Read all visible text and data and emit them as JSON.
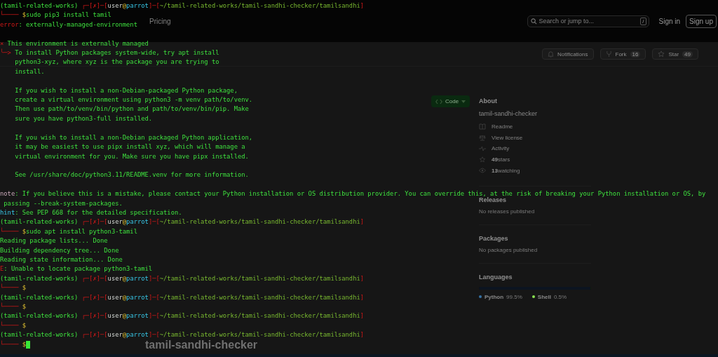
{
  "background_page": {
    "header": {
      "nav_item": "Pricing",
      "search": {
        "placeholder": "Search or jump to...",
        "shortcut": "/"
      },
      "sign_in": "Sign in",
      "sign_up": "Sign up"
    },
    "repo_actions": [
      {
        "kind": "notifications",
        "label": "Notifications"
      },
      {
        "kind": "fork",
        "label": "Fork",
        "count": "16"
      },
      {
        "kind": "star",
        "label": "Star",
        "count": "49"
      }
    ],
    "code_button": "Code",
    "about": {
      "title": "About",
      "description": "tamil-sandhi-checker",
      "links": [
        {
          "kind": "readme",
          "label": "Readme"
        },
        {
          "kind": "license",
          "label": "View license"
        },
        {
          "kind": "activity",
          "label": "Activity"
        },
        {
          "kind": "stars",
          "count": "49",
          "label": "stars"
        },
        {
          "kind": "watching",
          "count": "13",
          "label": "watching"
        }
      ]
    },
    "sections": [
      {
        "title": "Releases",
        "note": "No releases published"
      },
      {
        "title": "Packages",
        "note": "No packages published"
      }
    ],
    "languages": {
      "title": "Languages",
      "items": [
        {
          "name": "Python",
          "share": "99.5%",
          "level": 0.995,
          "color": "#3572a5"
        },
        {
          "name": "Shell",
          "share": "0.5%",
          "level": 0.005,
          "color": "#89e051"
        }
      ]
    },
    "repo_title": "tamil-sandhi-checker"
  },
  "terminal": {
    "lines": [
      {
        "kind": "text",
        "cursor": false,
        "segments": [
          {
            "kind": "env",
            "text": "(tamil-related-works) "
          },
          {
            "kind": "frame",
            "text": "┌─["
          },
          {
            "kind": "status",
            "text": "✗"
          },
          {
            "kind": "frame",
            "text": "]─["
          },
          {
            "kind": "user",
            "text": "user"
          },
          {
            "kind": "at",
            "text": "@"
          },
          {
            "kind": "host",
            "text": "parrot"
          },
          {
            "kind": "frame",
            "text": "]─["
          },
          {
            "kind": "path",
            "text": "~/tamil-related-works/tamil-sandhi-checker/tamilsandhi"
          },
          {
            "kind": "frame",
            "text": "]"
          }
        ]
      },
      {
        "kind": "text",
        "cursor": false,
        "segments": [
          {
            "kind": "frame",
            "text": "└──── "
          },
          {
            "kind": "dollar",
            "text": "$"
          },
          {
            "kind": "plain",
            "text": "sudo pip3 install tamil"
          }
        ]
      },
      {
        "kind": "text",
        "cursor": false,
        "segments": [
          {
            "kind": "error",
            "text": "error"
          },
          {
            "kind": "plain",
            "text": ": externally-managed-environment"
          }
        ]
      },
      {
        "kind": "blank"
      },
      {
        "kind": "text",
        "cursor": false,
        "segments": [
          {
            "kind": "error",
            "text": "× "
          },
          {
            "kind": "plain",
            "text": "This environment is externally managed"
          }
        ]
      },
      {
        "kind": "text",
        "cursor": false,
        "segments": [
          {
            "kind": "error",
            "text": "╰─> "
          },
          {
            "kind": "plain",
            "text": "To install Python packages system-wide, try apt install"
          }
        ]
      },
      {
        "kind": "text",
        "cursor": false,
        "segments": [
          {
            "kind": "plain",
            "text": "    python3-xyz, where xyz is the package you are trying to"
          }
        ]
      },
      {
        "kind": "text",
        "cursor": false,
        "segments": [
          {
            "kind": "plain",
            "text": "    install."
          }
        ]
      },
      {
        "kind": "blank"
      },
      {
        "kind": "text",
        "cursor": false,
        "segments": [
          {
            "kind": "plain",
            "text": "    If you wish to install a non-Debian-packaged Python package,"
          }
        ]
      },
      {
        "kind": "text",
        "cursor": false,
        "segments": [
          {
            "kind": "plain",
            "text": "    create a virtual environment using python3 -m venv path/to/venv."
          }
        ]
      },
      {
        "kind": "text",
        "cursor": false,
        "segments": [
          {
            "kind": "plain",
            "text": "    Then use path/to/venv/bin/python and path/to/venv/bin/pip. Make"
          }
        ]
      },
      {
        "kind": "text",
        "cursor": false,
        "segments": [
          {
            "kind": "plain",
            "text": "    sure you have python3-full installed."
          }
        ]
      },
      {
        "kind": "blank"
      },
      {
        "kind": "text",
        "cursor": false,
        "segments": [
          {
            "kind": "plain",
            "text": "    If you wish to install a non-Debian packaged Python application,"
          }
        ]
      },
      {
        "kind": "text",
        "cursor": false,
        "segments": [
          {
            "kind": "plain",
            "text": "    it may be easiest to use pipx install xyz, which will manage a"
          }
        ]
      },
      {
        "kind": "text",
        "cursor": false,
        "segments": [
          {
            "kind": "plain",
            "text": "    virtual environment for you. Make sure you have pipx installed."
          }
        ]
      },
      {
        "kind": "blank"
      },
      {
        "kind": "text",
        "cursor": false,
        "segments": [
          {
            "kind": "plain",
            "text": "    See /usr/share/doc/python3.11/README.venv for more information."
          }
        ]
      },
      {
        "kind": "blank"
      },
      {
        "kind": "text",
        "cursor": false,
        "segments": [
          {
            "kind": "note",
            "text": "note"
          },
          {
            "kind": "plain",
            "text": ": If you believe this is a mistake, please contact your Python installation or OS distribution provider. You can override this, at the risk of breaking your Python installation or OS, by"
          }
        ]
      },
      {
        "kind": "text",
        "cursor": false,
        "segments": [
          {
            "kind": "plain",
            "text": " passing --break-system-packages."
          }
        ]
      },
      {
        "kind": "text",
        "cursor": false,
        "segments": [
          {
            "kind": "hint",
            "text": "hint"
          },
          {
            "kind": "plain",
            "text": ": See PEP 668 for the detailed specification."
          }
        ]
      },
      {
        "kind": "text",
        "cursor": false,
        "segments": [
          {
            "kind": "env",
            "text": "(tamil-related-works) "
          },
          {
            "kind": "frame",
            "text": "┌─["
          },
          {
            "kind": "status",
            "text": "✗"
          },
          {
            "kind": "frame",
            "text": "]─["
          },
          {
            "kind": "user",
            "text": "user"
          },
          {
            "kind": "at",
            "text": "@"
          },
          {
            "kind": "host",
            "text": "parrot"
          },
          {
            "kind": "frame",
            "text": "]─["
          },
          {
            "kind": "path",
            "text": "~/tamil-related-works/tamil-sandhi-checker/tamilsandhi"
          },
          {
            "kind": "frame",
            "text": "]"
          }
        ]
      },
      {
        "kind": "text",
        "cursor": false,
        "segments": [
          {
            "kind": "frame",
            "text": "└──── "
          },
          {
            "kind": "dollar",
            "text": "$"
          },
          {
            "kind": "plain",
            "text": "sudo apt install python3-tamil"
          }
        ]
      },
      {
        "kind": "text",
        "cursor": false,
        "segments": [
          {
            "kind": "plain",
            "text": "Reading package lists... Done"
          }
        ]
      },
      {
        "kind": "text",
        "cursor": false,
        "segments": [
          {
            "kind": "plain",
            "text": "Building dependency tree... Done"
          }
        ]
      },
      {
        "kind": "text",
        "cursor": false,
        "segments": [
          {
            "kind": "plain",
            "text": "Reading state information... Done"
          }
        ]
      },
      {
        "kind": "text",
        "cursor": false,
        "segments": [
          {
            "kind": "error",
            "text": "E"
          },
          {
            "kind": "plain",
            "text": ": Unable to locate package python3-tamil"
          }
        ]
      },
      {
        "kind": "text",
        "cursor": false,
        "segments": [
          {
            "kind": "env",
            "text": "(tamil-related-works) "
          },
          {
            "kind": "frame",
            "text": "┌─["
          },
          {
            "kind": "status",
            "text": "✗"
          },
          {
            "kind": "frame",
            "text": "]─["
          },
          {
            "kind": "user",
            "text": "user"
          },
          {
            "kind": "at",
            "text": "@"
          },
          {
            "kind": "host",
            "text": "parrot"
          },
          {
            "kind": "frame",
            "text": "]─["
          },
          {
            "kind": "path",
            "text": "~/tamil-related-works/tamil-sandhi-checker/tamilsandhi"
          },
          {
            "kind": "frame",
            "text": "]"
          }
        ]
      },
      {
        "kind": "text",
        "cursor": false,
        "segments": [
          {
            "kind": "frame",
            "text": "└──── "
          },
          {
            "kind": "dollar",
            "text": "$"
          }
        ]
      },
      {
        "kind": "text",
        "cursor": false,
        "segments": [
          {
            "kind": "env",
            "text": "(tamil-related-works) "
          },
          {
            "kind": "frame",
            "text": "┌─["
          },
          {
            "kind": "status",
            "text": "✗"
          },
          {
            "kind": "frame",
            "text": "]─["
          },
          {
            "kind": "user",
            "text": "user"
          },
          {
            "kind": "at",
            "text": "@"
          },
          {
            "kind": "host",
            "text": "parrot"
          },
          {
            "kind": "frame",
            "text": "]─["
          },
          {
            "kind": "path",
            "text": "~/tamil-related-works/tamil-sandhi-checker/tamilsandhi"
          },
          {
            "kind": "frame",
            "text": "]"
          }
        ]
      },
      {
        "kind": "text",
        "cursor": false,
        "segments": [
          {
            "kind": "frame",
            "text": "└──── "
          },
          {
            "kind": "dollar",
            "text": "$"
          }
        ]
      },
      {
        "kind": "text",
        "cursor": false,
        "segments": [
          {
            "kind": "env",
            "text": "(tamil-related-works) "
          },
          {
            "kind": "frame",
            "text": "┌─["
          },
          {
            "kind": "status",
            "text": "✗"
          },
          {
            "kind": "frame",
            "text": "]─["
          },
          {
            "kind": "user",
            "text": "user"
          },
          {
            "kind": "at",
            "text": "@"
          },
          {
            "kind": "host",
            "text": "parrot"
          },
          {
            "kind": "frame",
            "text": "]─["
          },
          {
            "kind": "path",
            "text": "~/tamil-related-works/tamil-sandhi-checker/tamilsandhi"
          },
          {
            "kind": "frame",
            "text": "]"
          }
        ]
      },
      {
        "kind": "text",
        "cursor": false,
        "segments": [
          {
            "kind": "frame",
            "text": "└──── "
          },
          {
            "kind": "dollar",
            "text": "$"
          }
        ]
      },
      {
        "kind": "text",
        "cursor": false,
        "segments": [
          {
            "kind": "env",
            "text": "(tamil-related-works) "
          },
          {
            "kind": "frame",
            "text": "┌─["
          },
          {
            "kind": "status",
            "text": "✗"
          },
          {
            "kind": "frame",
            "text": "]─["
          },
          {
            "kind": "user",
            "text": "user"
          },
          {
            "kind": "at",
            "text": "@"
          },
          {
            "kind": "host",
            "text": "parrot"
          },
          {
            "kind": "frame",
            "text": "]─["
          },
          {
            "kind": "path",
            "text": "~/tamil-related-works/tamil-sandhi-checker/tamilsandhi"
          },
          {
            "kind": "frame",
            "text": "]"
          }
        ]
      },
      {
        "kind": "text",
        "cursor": true,
        "segments": [
          {
            "kind": "frame",
            "text": "└──── "
          },
          {
            "kind": "dollar",
            "text": "$"
          }
        ]
      }
    ]
  }
}
